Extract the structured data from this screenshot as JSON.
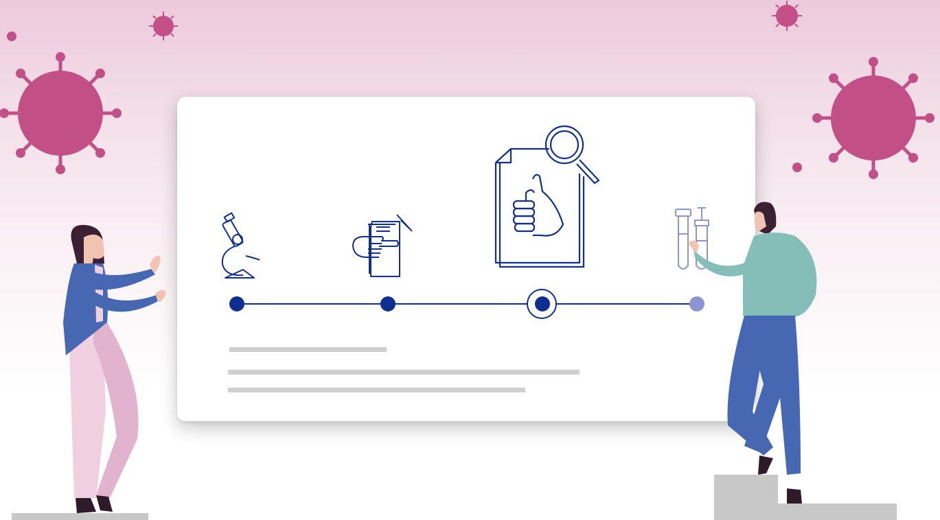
{
  "timeline": {
    "steps": [
      {
        "icon": "microscope-icon",
        "status": "done"
      },
      {
        "icon": "document-pointing-hand-syringe-icon",
        "status": "done"
      },
      {
        "icon": "thumbs-up-document-magnifier-icon",
        "status": "current"
      },
      {
        "icon": "test-tubes-icon",
        "status": "pending"
      }
    ]
  },
  "colors": {
    "virus": "#c24f85",
    "timeline": "#0e2f91",
    "pending_step": "#8c95cf",
    "placeholder_text": "#cfcfcf",
    "background_top": "#ecc9dc"
  }
}
